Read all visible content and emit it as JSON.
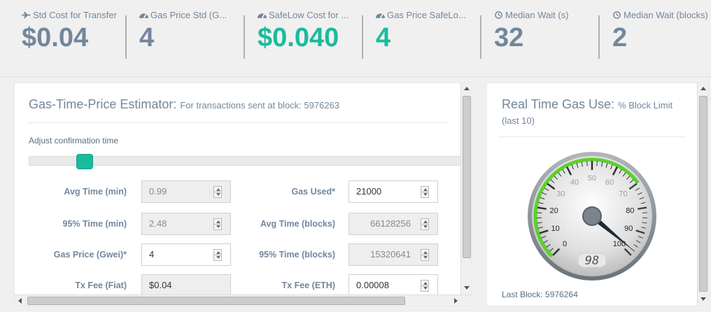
{
  "stats": [
    {
      "icon": "plane-icon",
      "label": "Std Cost for Transfer",
      "value": "$0.04",
      "color": "#73879C"
    },
    {
      "icon": "dashboard-icon",
      "label": "Gas Price Std (G...",
      "value": "4",
      "color": "#73879C"
    },
    {
      "icon": "dashboard-icon",
      "label": "SafeLow Cost for ...",
      "value": "$0.040",
      "color": "#1ABB9C"
    },
    {
      "icon": "dashboard-icon",
      "label": "Gas Price SafeLo...",
      "value": "4",
      "color": "#1ABB9C"
    },
    {
      "icon": "clock-icon",
      "label": "Median Wait (s)",
      "value": "32",
      "color": "#73879C"
    },
    {
      "icon": "clock-icon",
      "label": "Median Wait (blocks)",
      "value": "2",
      "color": "#73879C"
    }
  ],
  "estimator": {
    "title": "Gas-Time-Price Estimator:",
    "subtitle": "For transactions sent at block: 5976263",
    "adjust_label": "Adjust confirmation time",
    "fields_left": [
      {
        "label": "Avg Time (min)",
        "value": "0.99",
        "editable": false
      },
      {
        "label": "95% Time (min)",
        "value": "2.48",
        "editable": false
      },
      {
        "label": "Gas Price (Gwei)*",
        "value": "4",
        "editable": true
      },
      {
        "label": "Tx Fee (Fiat)",
        "value": "$0.04",
        "editable": false
      }
    ],
    "fields_right": [
      {
        "label": "Gas Used*",
        "value": "21000",
        "editable": true
      },
      {
        "label": "Avg Time (blocks)",
        "value": "66128256",
        "editable": false
      },
      {
        "label": "95% Time (blocks)",
        "value": "15320641",
        "editable": false
      },
      {
        "label": "Tx Fee (ETH)",
        "value": "0.00008",
        "editable": true
      }
    ]
  },
  "gas_use": {
    "title": "Real Time Gas Use:",
    "subtitle": "% Block Limit",
    "subtitle2": "(last 10)",
    "gauge_value": 98,
    "gauge_display": "98",
    "gauge_ticks": [
      "0",
      "10",
      "20",
      "30",
      "40",
      "50",
      "60",
      "70",
      "80",
      "90",
      "100"
    ],
    "last_block": "Last Block: 5976264",
    "accent": "#5ad12c"
  },
  "colors": {
    "accent": "#1ABB9C",
    "text": "#73879C"
  }
}
